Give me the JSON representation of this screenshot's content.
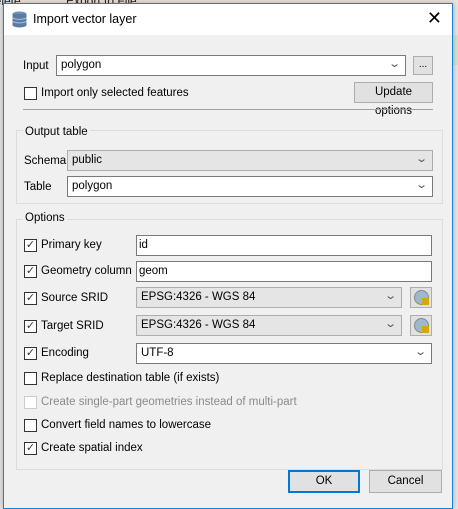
{
  "background": {
    "text1": "Delete",
    "text2": "Export to File"
  },
  "dialog": {
    "title": "Import vector layer",
    "icon": "database-icon"
  },
  "input": {
    "label": "Input",
    "value": "polygon",
    "browse_label": "...",
    "only_selected_label": "Import only selected features",
    "only_selected_checked": false,
    "update_label": "Update options"
  },
  "output": {
    "title": "Output table",
    "schema_label": "Schema",
    "schema_value": "public",
    "table_label": "Table",
    "table_value": "polygon"
  },
  "options": {
    "title": "Options",
    "primary_key": {
      "label": "Primary key",
      "checked": true,
      "value": "id"
    },
    "geometry_column": {
      "label": "Geometry column",
      "checked": true,
      "value": "geom"
    },
    "source_srid": {
      "label": "Source SRID",
      "checked": true,
      "value": "EPSG:4326 - WGS 84"
    },
    "target_srid": {
      "label": "Target SRID",
      "checked": true,
      "value": "EPSG:4326 - WGS 84"
    },
    "encoding": {
      "label": "Encoding",
      "checked": true,
      "value": "UTF-8"
    },
    "replace": {
      "label": "Replace destination table (if exists)",
      "checked": false
    },
    "single_part": {
      "label": "Create single-part geometries instead of multi-part",
      "checked": false,
      "disabled": true
    },
    "lowercase": {
      "label": "Convert field names to lowercase",
      "checked": false
    },
    "spatial_index": {
      "label": "Create spatial index",
      "checked": true
    }
  },
  "buttons": {
    "ok": "OK",
    "cancel": "Cancel"
  },
  "colors": {
    "accent": "#0078d7"
  }
}
